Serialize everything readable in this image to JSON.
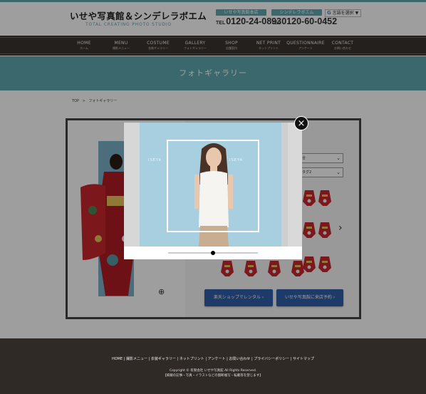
{
  "header": {
    "logo_title": "いせや写真館＆シンデレラボエム",
    "logo_subtitle": "TOTAL CREATING PHOTO STUDIO",
    "tel1_label": "いせや写真館本店",
    "tel1_prefix": "TEL",
    "tel1_number": "0120-24-0893",
    "tel2_label": "シンデレラボエム",
    "tel2_prefix": "TEL",
    "tel2_number": "0120-60-0452",
    "translate_g": "G",
    "translate_label": "言語を選択",
    "translate_arrow": "▼"
  },
  "nav": {
    "items": [
      {
        "en": "HOME",
        "jp": "ホーム"
      },
      {
        "en": "MENU",
        "jp": "撮影メニュー"
      },
      {
        "en": "COSTUME",
        "jp": "衣装ギャラリー"
      },
      {
        "en": "GALLERY",
        "jp": "フォトギャラリー"
      },
      {
        "en": "SHOP",
        "jp": "店舗案内"
      },
      {
        "en": "NET PRINT",
        "jp": "ネットプリント"
      },
      {
        "en": "QUESTIONNAIRE",
        "jp": "アンケート"
      },
      {
        "en": "CONTACT",
        "jp": "お問い合わせ"
      }
    ]
  },
  "banner": {
    "title": "フォトギャラリー"
  },
  "breadcrumb": {
    "top": "TOP",
    "sep": ">",
    "current": "フォトギャラリー"
  },
  "gallery": {
    "select1_value": "合",
    "select2_value": "タグ2",
    "chevron": "⌄",
    "next_arrow": "›",
    "zoom_icon": "⊕",
    "btn_rakuten": "楽天ショップでレンタル",
    "btn_reserve": "いせや写真館に来店予約",
    "btn_arrow": "›"
  },
  "modal": {
    "watermark": "ISEYA",
    "close_glyph": "×",
    "slider_position": 0.5
  },
  "footer": {
    "links": [
      "HOME",
      "撮影メニュー",
      "衣装ギャラリー",
      "ネットプリント",
      "アンケート",
      "お問い合わせ",
      "プライバシーポリシー",
      "サイトマップ"
    ],
    "copyright": "Copyright © 有限会社 いせや写真館 All Rights Reserved.",
    "notice": "【掲載の記事・写真・イラストなどの無断複写・転載等を禁じます】"
  },
  "colors": {
    "accent": "#5fa9b0",
    "nav_bg": "#3a3430",
    "footer_bg": "#2f2a25",
    "button": "#2f5ea8"
  }
}
